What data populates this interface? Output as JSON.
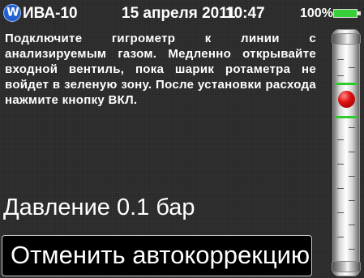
{
  "status_bar": {
    "logo_text": "W",
    "device_name": "ИВА-10",
    "date": "15 апреля 2011",
    "time": "10:47",
    "battery_percent": "100%",
    "battery_level": 1.0,
    "battery_color": "#38d038"
  },
  "instructions": {
    "text": "Подключите гигрометр к линии с анализируемым газом. Медленно открывайте входной вентиль, пока шарик ротаметра не войдет в зеленую зону. После установки расхода нажмите кнопку ВКЛ."
  },
  "pressure": {
    "text": "Давление 0.1 бар"
  },
  "cancel_button": {
    "label": "Отменить автокоррекцию"
  },
  "rotameter": {
    "ball_color": "#e01010",
    "zone_color": "#2ecb2e"
  }
}
